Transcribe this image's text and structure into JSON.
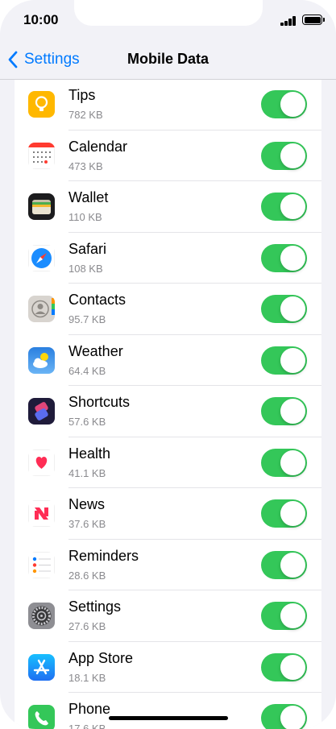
{
  "status_bar": {
    "time": "10:00"
  },
  "nav": {
    "back_label": "Settings",
    "title": "Mobile Data"
  },
  "apps": [
    {
      "name": "Tips",
      "size": "782 KB",
      "icon": "tips-icon",
      "enabled": true
    },
    {
      "name": "Calendar",
      "size": "473 KB",
      "icon": "calendar-icon",
      "enabled": true
    },
    {
      "name": "Wallet",
      "size": "110 KB",
      "icon": "wallet-icon",
      "enabled": true
    },
    {
      "name": "Safari",
      "size": "108 KB",
      "icon": "safari-icon",
      "enabled": true
    },
    {
      "name": "Contacts",
      "size": "95.7 KB",
      "icon": "contacts-icon",
      "enabled": true
    },
    {
      "name": "Weather",
      "size": "64.4 KB",
      "icon": "weather-icon",
      "enabled": true
    },
    {
      "name": "Shortcuts",
      "size": "57.6 KB",
      "icon": "shortcuts-icon",
      "enabled": true
    },
    {
      "name": "Health",
      "size": "41.1 KB",
      "icon": "health-icon",
      "enabled": true
    },
    {
      "name": "News",
      "size": "37.6 KB",
      "icon": "news-icon",
      "enabled": true
    },
    {
      "name": "Reminders",
      "size": "28.6 KB",
      "icon": "reminders-icon",
      "enabled": true
    },
    {
      "name": "Settings",
      "size": "27.6 KB",
      "icon": "settings-icon",
      "enabled": true
    },
    {
      "name": "App Store",
      "size": "18.1 KB",
      "icon": "app-store-icon",
      "enabled": true
    },
    {
      "name": "Phone",
      "size": "17.6 KB",
      "icon": "phone-icon",
      "enabled": true
    }
  ],
  "colors": {
    "accent": "#007aff",
    "toggle_on": "#34c759"
  }
}
